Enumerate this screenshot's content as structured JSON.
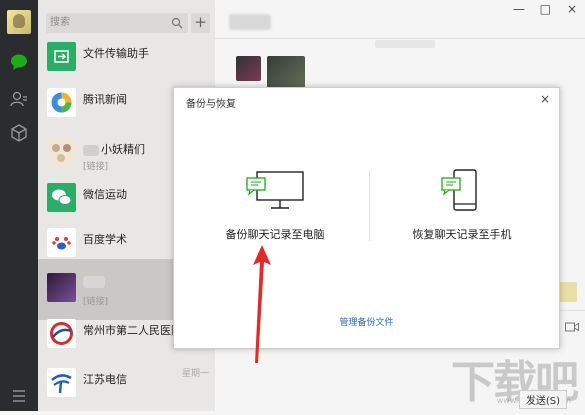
{
  "search": {
    "placeholder": "搜索",
    "add_label": "+"
  },
  "chats": [
    {
      "name": "文件传输助手",
      "sub": "",
      "time": "",
      "icon": "file-transfer-icon",
      "color": "#2aae67"
    },
    {
      "name": "腾讯新闻",
      "sub": "",
      "time": "",
      "icon": "tencent-news-icon",
      "color": "#3a8fd8"
    },
    {
      "name": "小妖精们",
      "sub": "[链接]",
      "time": "",
      "icon": "group-avatar-icon",
      "color": "#e8d9c8"
    },
    {
      "name": "微信运动",
      "sub": "",
      "time": "",
      "icon": "wechat-sport-icon",
      "color": "#2aae67"
    },
    {
      "name": "百度学术",
      "sub": "",
      "time": "",
      "icon": "baidu-scholar-icon",
      "color": "#ffffff"
    },
    {
      "name": "",
      "sub": "[链接]",
      "time": "",
      "icon": "user-avatar-icon",
      "color": "#4a2f5a"
    },
    {
      "name": "常州市第二人民医院",
      "sub": "",
      "time": "",
      "icon": "hospital-logo-icon",
      "color": "#ffffff"
    },
    {
      "name": "江苏电信",
      "sub": "",
      "time": "星期一",
      "icon": "china-telecom-icon",
      "color": "#ffffff"
    }
  ],
  "window": {
    "minimize": "—",
    "maximize": "□",
    "close": "×"
  },
  "modal": {
    "title": "备份与恢复",
    "close": "×",
    "backup_label": "备份聊天记录至电脑",
    "restore_label": "恢复聊天记录至手机",
    "manage_label": "管理备份文件"
  },
  "footer": {
    "send_label": "发送(S)"
  },
  "watermark": {
    "main": "下载吧",
    "sub": "www.xiazaiba.com"
  },
  "colors": {
    "rail": "#2b2c2f",
    "wechat_green": "#1aad19",
    "link_blue": "#2a6bb8",
    "arrow_red": "#e02b2b"
  }
}
